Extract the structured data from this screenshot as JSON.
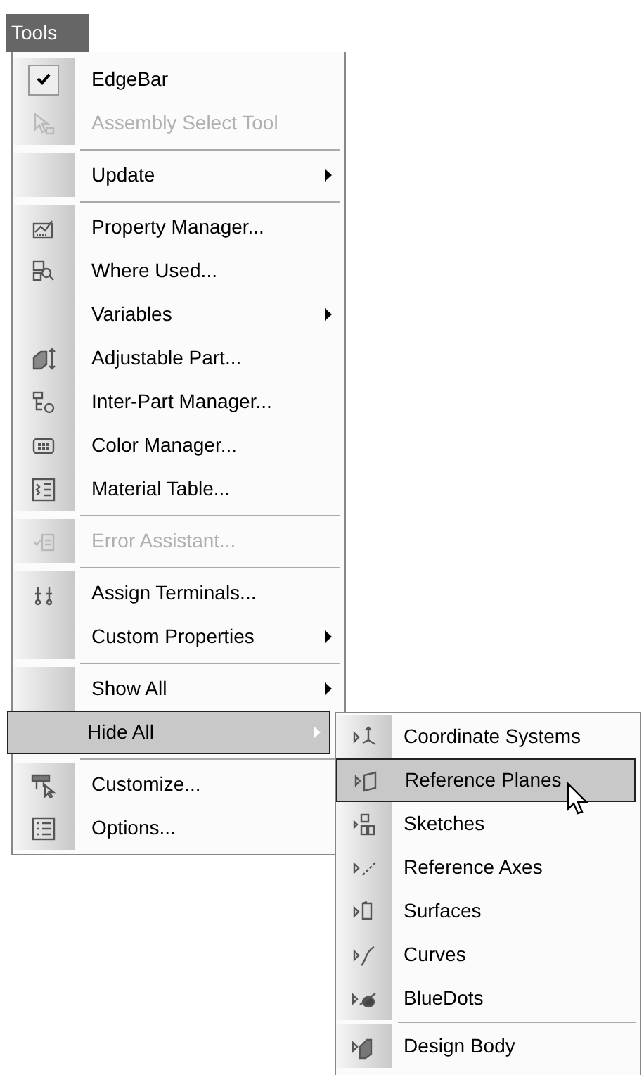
{
  "menu_bar": {
    "title": "Tools"
  },
  "menu": {
    "items": [
      {
        "kind": "item",
        "label": "EdgeBar",
        "checked": true,
        "disabled": false,
        "submenu": false,
        "selected": false
      },
      {
        "kind": "item",
        "label": "Assembly Select Tool",
        "checked": false,
        "disabled": true,
        "submenu": false,
        "selected": false
      },
      {
        "kind": "separator"
      },
      {
        "kind": "item",
        "label": "Update",
        "checked": false,
        "disabled": false,
        "submenu": true,
        "selected": false
      },
      {
        "kind": "separator"
      },
      {
        "kind": "item",
        "label": "Property Manager...",
        "checked": false,
        "disabled": false,
        "submenu": false,
        "selected": false
      },
      {
        "kind": "item",
        "label": "Where Used...",
        "checked": false,
        "disabled": false,
        "submenu": false,
        "selected": false
      },
      {
        "kind": "item",
        "label": "Variables",
        "checked": false,
        "disabled": false,
        "submenu": true,
        "selected": false
      },
      {
        "kind": "item",
        "label": "Adjustable Part...",
        "checked": false,
        "disabled": false,
        "submenu": false,
        "selected": false
      },
      {
        "kind": "item",
        "label": "Inter-Part Manager...",
        "checked": false,
        "disabled": false,
        "submenu": false,
        "selected": false
      },
      {
        "kind": "item",
        "label": "Color Manager...",
        "checked": false,
        "disabled": false,
        "submenu": false,
        "selected": false
      },
      {
        "kind": "item",
        "label": "Material Table...",
        "checked": false,
        "disabled": false,
        "submenu": false,
        "selected": false
      },
      {
        "kind": "separator"
      },
      {
        "kind": "item",
        "label": "Error Assistant...",
        "checked": false,
        "disabled": true,
        "submenu": false,
        "selected": false
      },
      {
        "kind": "separator"
      },
      {
        "kind": "item",
        "label": "Assign Terminals...",
        "checked": false,
        "disabled": false,
        "submenu": false,
        "selected": false
      },
      {
        "kind": "item",
        "label": "Custom Properties",
        "checked": false,
        "disabled": false,
        "submenu": true,
        "selected": false
      },
      {
        "kind": "separator"
      },
      {
        "kind": "item",
        "label": "Show All",
        "checked": false,
        "disabled": false,
        "submenu": true,
        "selected": false
      },
      {
        "kind": "item",
        "label": "Hide All",
        "checked": false,
        "disabled": false,
        "submenu": true,
        "selected": true
      },
      {
        "kind": "separator"
      },
      {
        "kind": "item",
        "label": "Customize...",
        "checked": false,
        "disabled": false,
        "submenu": false,
        "selected": false
      },
      {
        "kind": "item",
        "label": "Options...",
        "checked": false,
        "disabled": false,
        "submenu": false,
        "selected": false
      }
    ]
  },
  "submenu": {
    "items": [
      {
        "kind": "item",
        "label": "Coordinate Systems",
        "selected": false
      },
      {
        "kind": "item",
        "label": "Reference Planes",
        "selected": true
      },
      {
        "kind": "item",
        "label": "Sketches",
        "selected": false
      },
      {
        "kind": "item",
        "label": "Reference Axes",
        "selected": false
      },
      {
        "kind": "item",
        "label": "Surfaces",
        "selected": false
      },
      {
        "kind": "item",
        "label": "Curves",
        "selected": false
      },
      {
        "kind": "item",
        "label": "BlueDots",
        "selected": false
      },
      {
        "kind": "separator"
      },
      {
        "kind": "item",
        "label": "Design Body",
        "selected": false
      }
    ]
  }
}
